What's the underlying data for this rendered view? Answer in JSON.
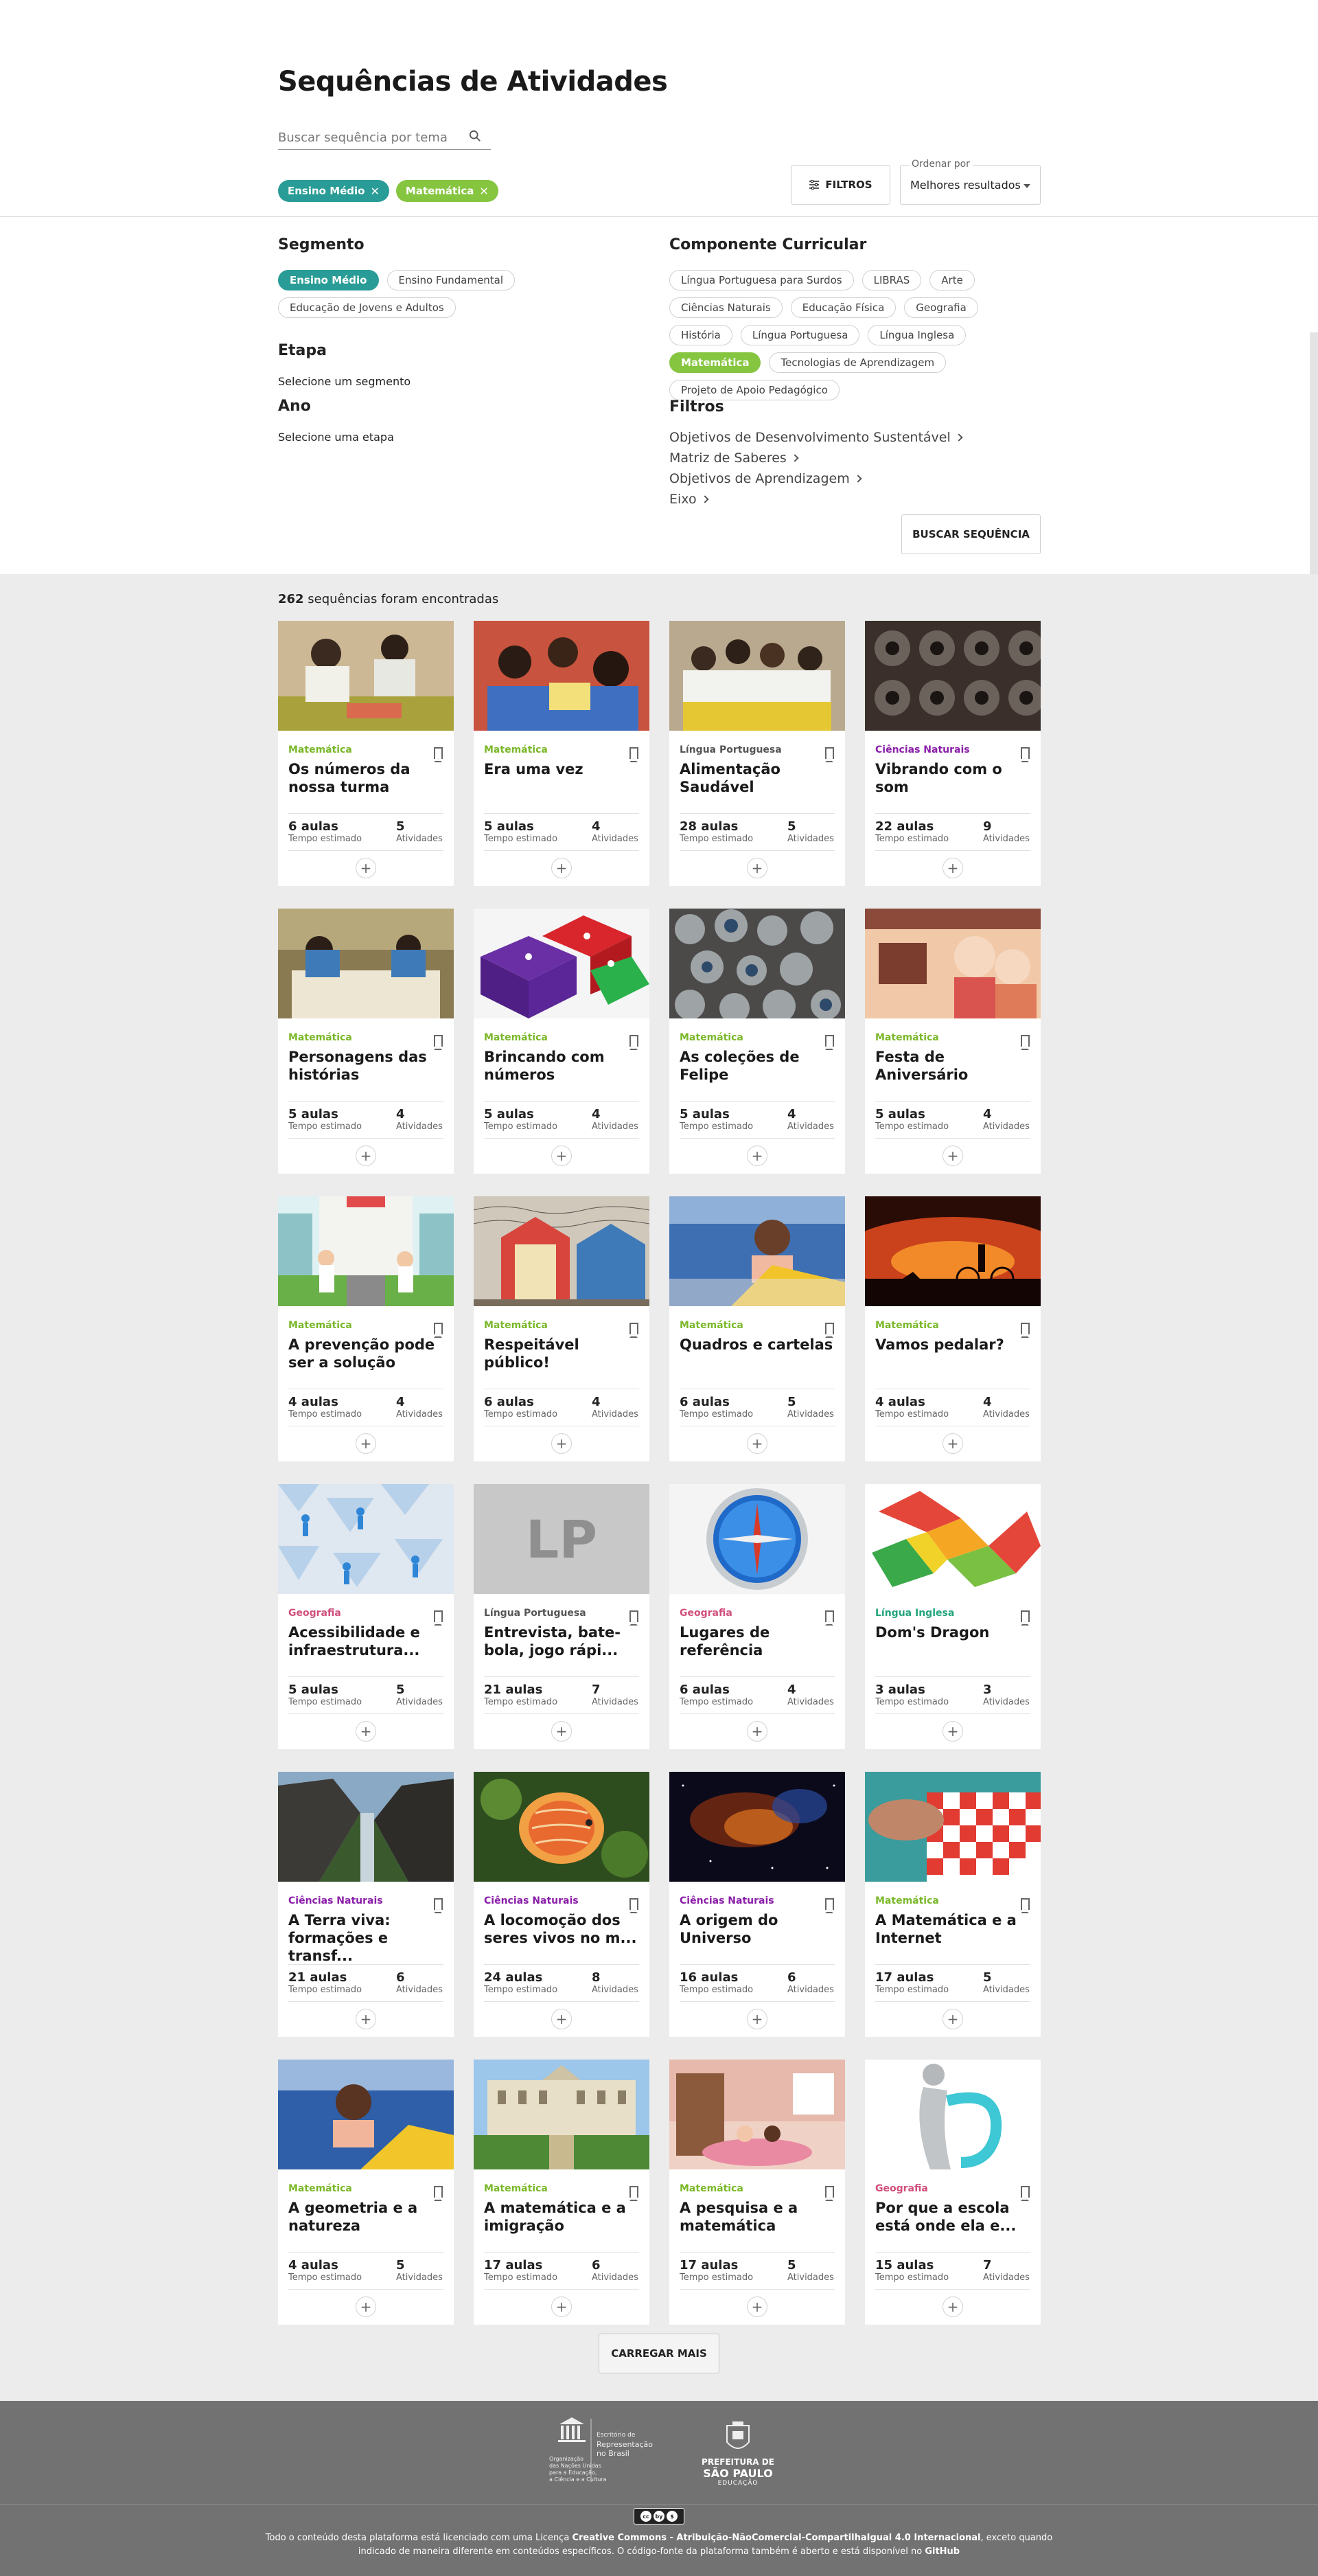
{
  "page": {
    "title": "Sequências de Atividades"
  },
  "search": {
    "placeholder": "Buscar sequência por tema"
  },
  "active_filters": [
    {
      "label": "Ensino Médio",
      "color": "#2a9c97"
    },
    {
      "label": "Matemática",
      "color": "#86c540"
    }
  ],
  "toolbar": {
    "filters_label": "FILTROS",
    "order_label": "Ordenar por",
    "order_value": "Melhores resultados"
  },
  "filters": {
    "segmento": {
      "heading": "Segmento",
      "options": [
        {
          "label": "Ensino Médio",
          "selected": true
        },
        {
          "label": "Ensino Fundamental",
          "selected": false
        },
        {
          "label": "Educação de Jovens e Adultos",
          "selected": false
        }
      ]
    },
    "etapa": {
      "heading": "Etapa",
      "hint": "Selecione um segmento"
    },
    "ano": {
      "heading": "Ano",
      "hint": "Selecione uma etapa"
    },
    "componente": {
      "heading": "Componente Curricular",
      "options": [
        {
          "label": "Língua Portuguesa para Surdos",
          "selected": false
        },
        {
          "label": "LIBRAS",
          "selected": false
        },
        {
          "label": "Arte",
          "selected": false
        },
        {
          "label": "Ciências Naturais",
          "selected": false
        },
        {
          "label": "Educação Física",
          "selected": false
        },
        {
          "label": "Geografia",
          "selected": false
        },
        {
          "label": "História",
          "selected": false
        },
        {
          "label": "Língua Portuguesa",
          "selected": false
        },
        {
          "label": "Língua Inglesa",
          "selected": false
        },
        {
          "label": "Matemática",
          "selected": true
        },
        {
          "label": "Tecnologias de Aprendizagem",
          "selected": false
        },
        {
          "label": "Projeto de Apoio Pedagógico",
          "selected": false
        }
      ]
    },
    "filtros": {
      "heading": "Filtros",
      "links": [
        "Objetivos de Desenvolvimento Sustentável",
        "Matriz de Saberes",
        "Objetivos de Aprendizagem",
        "Eixo"
      ]
    },
    "search_button": "BUSCAR SEQUÊNCIA"
  },
  "results": {
    "count": "262",
    "count_suffix": " sequências foram encontradas",
    "subject_colors": {
      "Matemática": "#7ab829",
      "Língua Portuguesa": "#555555",
      "Ciências Naturais": "#8b1fa9",
      "Geografia": "#d04e7c",
      "Língua Inglesa": "#23a57c"
    },
    "aulas_label": "Tempo estimado",
    "atividades_label": "Atividades",
    "cards": [
      {
        "subject": "Matemática",
        "title": "Os números da nossa turma",
        "aulas": "6 aulas",
        "atividades": "5",
        "img": "kids-table"
      },
      {
        "subject": "Matemática",
        "title": "Era uma vez",
        "aulas": "5 aulas",
        "atividades": "4",
        "img": "kids-floor"
      },
      {
        "subject": "Língua Portuguesa",
        "title": "Alimentação Saudável",
        "aulas": "28 aulas",
        "atividades": "5",
        "img": "kids-bananas"
      },
      {
        "subject": "Ciências Naturais",
        "title": "Vibrando com o som",
        "aulas": "22 aulas",
        "atividades": "9",
        "img": "speakers"
      },
      {
        "subject": "Matemática",
        "title": "Personagens das histórias",
        "aulas": "5 aulas",
        "atividades": "4",
        "img": "classroom"
      },
      {
        "subject": "Matemática",
        "title": "Brincando com números",
        "aulas": "5 aulas",
        "atividades": "4",
        "img": "dice"
      },
      {
        "subject": "Matemática",
        "title": "As coleções de Felipe",
        "aulas": "5 aulas",
        "atividades": "4",
        "img": "marbles"
      },
      {
        "subject": "Matemática",
        "title": "Festa de Aniversário",
        "aulas": "5 aulas",
        "atividades": "4",
        "img": "birthday"
      },
      {
        "subject": "Matemática",
        "title": "A prevenção pode ser a solução",
        "aulas": "4 aulas",
        "atividades": "4",
        "img": "hospital"
      },
      {
        "subject": "Matemática",
        "title": "Respeitável público!",
        "aulas": "6 aulas",
        "atividades": "4",
        "img": "circus"
      },
      {
        "subject": "Matemática",
        "title": "Quadros e cartelas",
        "aulas": "6 aulas",
        "atividades": "5",
        "img": "girl-paper"
      },
      {
        "subject": "Matemática",
        "title": "Vamos pedalar?",
        "aulas": "4 aulas",
        "atividades": "4",
        "img": "sunset-bike"
      },
      {
        "subject": "Geografia",
        "title": "Acessibilidade e infraestrutura...",
        "aulas": "5 aulas",
        "atividades": "5",
        "img": "accessibility"
      },
      {
        "subject": "Língua Portuguesa",
        "title": "Entrevista, bate-bola, jogo rápi...",
        "aulas": "21 aulas",
        "atividades": "7",
        "img": "lp-placeholder",
        "placeholder": "LP"
      },
      {
        "subject": "Geografia",
        "title": "Lugares de referência",
        "aulas": "6 aulas",
        "atividades": "4",
        "img": "compass"
      },
      {
        "subject": "Língua Inglesa",
        "title": "Dom's Dragon",
        "aulas": "3 aulas",
        "atividades": "3",
        "img": "dragon"
      },
      {
        "subject": "Ciências Naturais",
        "title": "A Terra viva: formações e transf...",
        "aulas": "21 aulas",
        "atividades": "6",
        "img": "canyon"
      },
      {
        "subject": "Ciências Naturais",
        "title": "A locomoção dos seres vivos no m...",
        "aulas": "24 aulas",
        "atividades": "8",
        "img": "fish"
      },
      {
        "subject": "Ciências Naturais",
        "title": "A origem do Universo",
        "aulas": "16 aulas",
        "atividades": "6",
        "img": "space"
      },
      {
        "subject": "Matemática",
        "title": "A Matemática e a Internet",
        "aulas": "17 aulas",
        "atividades": "5",
        "img": "checkers"
      },
      {
        "subject": "Matemática",
        "title": "A geometria e a natureza",
        "aulas": "4 aulas",
        "atividades": "5",
        "img": "girl-paper2"
      },
      {
        "subject": "Matemática",
        "title": "A matemática e a imigração",
        "aulas": "17 aulas",
        "atividades": "6",
        "img": "museum"
      },
      {
        "subject": "Matemática",
        "title": "A pesquisa e a matemática",
        "aulas": "17 aulas",
        "atividades": "5",
        "img": "bedroom"
      },
      {
        "subject": "Geografia",
        "title": "Por que a escola está onde ela e...",
        "aulas": "15 aulas",
        "atividades": "7",
        "img": "figure-3d"
      }
    ],
    "load_more": "CARREGAR MAIS"
  },
  "footer": {
    "unesco_lines": [
      "Organização",
      "das Nações Unidas",
      "para a Educação,",
      "a Ciência e a Cultura"
    ],
    "unesco_rep": [
      "Escritório de",
      "Representação",
      "no Brasil"
    ],
    "prefeitura": [
      "PREFEITURA DE",
      "SÃO PAULO",
      "EDUCAÇÃO"
    ],
    "license_pre": "Todo o conteúdo desta plataforma está licenciado com uma Licença ",
    "license_name": "Creative Commons - Atribuição-NãoComercial-CompartilhaIgual 4.0 Internacional",
    "license_post": ", exceto quando indicado de maneira diferente em conteúdos específicos. O código-fonte da plataforma também é aberto e está disponível no ",
    "github": "GitHub"
  }
}
